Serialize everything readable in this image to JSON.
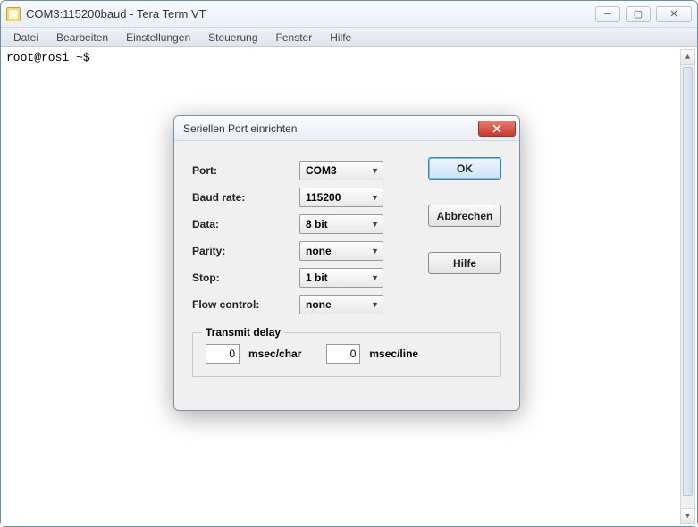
{
  "window": {
    "title": "COM3:115200baud - Tera Term VT"
  },
  "menubar": {
    "items": [
      "Datei",
      "Bearbeiten",
      "Einstellungen",
      "Steuerung",
      "Fenster",
      "Hilfe"
    ]
  },
  "terminal": {
    "prompt": "root@rosi ~$"
  },
  "dialog": {
    "title": "Seriellen Port einrichten",
    "labels": {
      "port": "Port:",
      "baud": "Baud rate:",
      "data": "Data:",
      "parity": "Parity:",
      "stop": "Stop:",
      "flow": "Flow control:"
    },
    "values": {
      "port": "COM3",
      "baud": "115200",
      "data": "8 bit",
      "parity": "none",
      "stop": "1 bit",
      "flow": "none"
    },
    "buttons": {
      "ok": "OK",
      "cancel": "Abbrechen",
      "help": "Hilfe"
    },
    "transmit": {
      "legend": "Transmit delay",
      "char_value": "0",
      "char_unit": "msec/char",
      "line_value": "0",
      "line_unit": "msec/line"
    }
  }
}
